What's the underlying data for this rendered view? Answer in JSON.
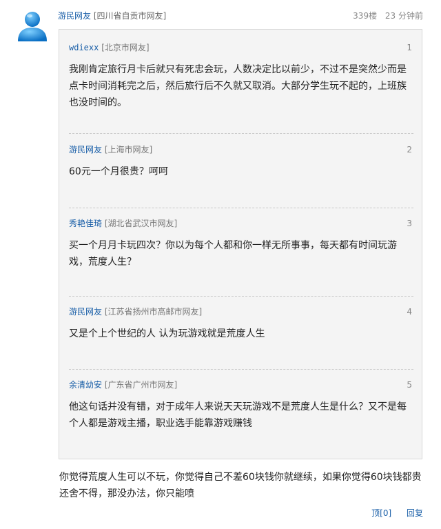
{
  "post": {
    "username": "游民网友",
    "location": "[四川省自贡市网友]",
    "floor_number": "339楼",
    "time": "23 分钟前"
  },
  "quoted": [
    {
      "username": "wdiexx",
      "location": "[北京市网友]",
      "index": "1",
      "text": "我刚肯定旅行月卡后就只有死忠会玩，人数决定比以前少，不过不是突然少而是点卡时间消耗完之后，然后旅行后不久就又取消。大部分学生玩不起的，上班族也没时间的。"
    },
    {
      "username": "游民网友",
      "location": "[上海市网友]",
      "index": "2",
      "text": "60元一个月很贵？呵呵"
    },
    {
      "username": "秀艳佳琦",
      "location": "[湖北省武汉市网友]",
      "index": "3",
      "text": "买一个月月卡玩四次？你以为每个人都和你一样无所事事，每天都有时间玩游戏，荒度人生？"
    },
    {
      "username": "游民网友",
      "location": "[江苏省扬州市高邮市网友]",
      "index": "4",
      "text": "又是个上个世纪的人 认为玩游戏就是荒度人生"
    },
    {
      "username": "余清幼安",
      "location": "[广东省广州市网友]",
      "index": "5",
      "text": "他这句话并没有错，对于成年人来说天天玩游戏不是荒度人生是什么？又不是每个人都是游戏主播，职业选手能靠游戏赚钱"
    }
  ],
  "reply_text": "你觉得荒度人生可以不玩，你觉得自己不差60块钱你就继续，如果你觉得60块钱都贵还舍不得，那没办法，你只能喷",
  "actions": {
    "top_label": "顶",
    "top_count": "[0]",
    "reply_label": "回复"
  },
  "icons": {
    "avatar": "user-avatar-icon"
  },
  "colors": {
    "link": "#1a5fa8",
    "quote_bg": "#f4f4f4"
  }
}
